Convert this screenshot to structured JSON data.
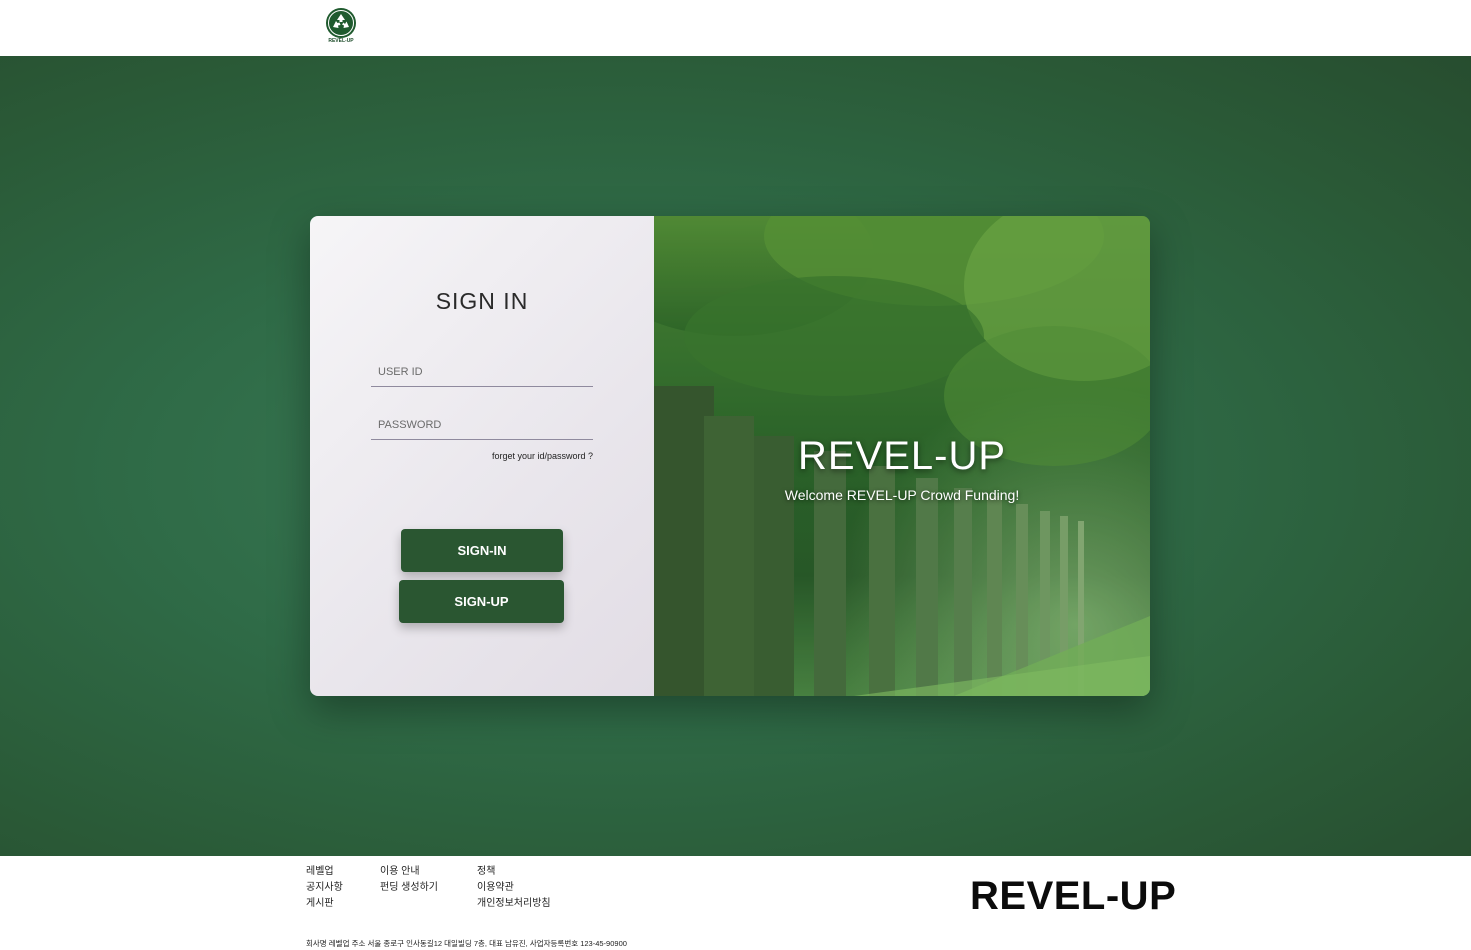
{
  "header": {
    "logo_text": "REVEL-UP",
    "logo_icon": "recycle-icon"
  },
  "login": {
    "title": "SIGN IN",
    "user_id_placeholder": "USER ID",
    "password_placeholder": "PASSWORD",
    "forget_link": "forget your id/password ?",
    "signin_label": "SIGN-IN",
    "signup_label": "SIGN-UP"
  },
  "promo": {
    "title": "REVEL-UP",
    "subtitle": "Welcome REVEL-UP Crowd Funding!"
  },
  "footer": {
    "col1": [
      "레벨업",
      "공지사항",
      "게시판"
    ],
    "col2": [
      "이용 안내",
      "펀딩 생성하기"
    ],
    "col3": [
      "정책",
      "이용약관",
      "개인정보처리방침"
    ],
    "brand": "REVEL-UP",
    "company_info": "회사명 레벨업 주소 서울 종로구 인사동길12 대일빌딩 7층, 대표 남유진, 사업자등록번호 123-45-90900"
  },
  "colors": {
    "brand_green": "#2a5631",
    "background_green": "#2f6b47"
  }
}
